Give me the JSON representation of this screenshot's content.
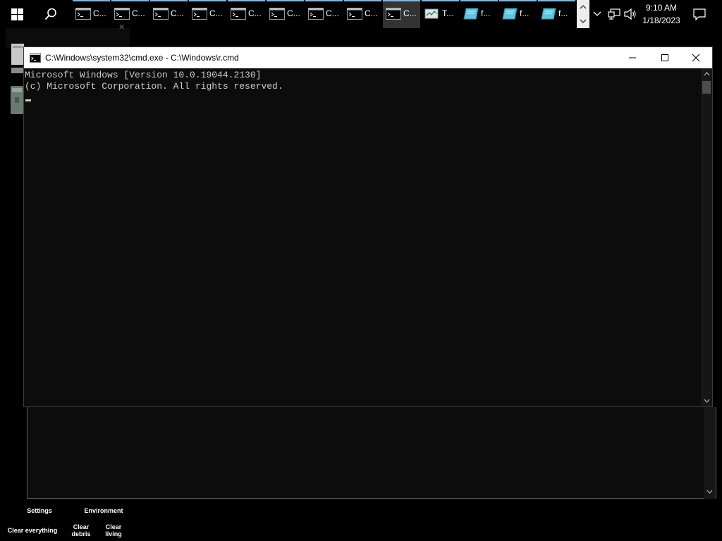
{
  "taskbar": {
    "tasks": [
      {
        "label": "C...",
        "icon": "cmd-icon",
        "active": false
      },
      {
        "label": "C...",
        "icon": "cmd-icon",
        "active": false
      },
      {
        "label": "C...",
        "icon": "cmd-icon",
        "active": false
      },
      {
        "label": "C...",
        "icon": "cmd-icon",
        "active": false
      },
      {
        "label": "C...",
        "icon": "cmd-icon",
        "active": false
      },
      {
        "label": "C...",
        "icon": "cmd-icon",
        "active": false
      },
      {
        "label": "C...",
        "icon": "cmd-icon",
        "active": false
      },
      {
        "label": "C...",
        "icon": "cmd-icon",
        "active": false
      },
      {
        "label": "C...",
        "icon": "cmd-icon",
        "active": true
      },
      {
        "label": "T...",
        "icon": "task-manager-icon",
        "active": false
      },
      {
        "label": "f...",
        "icon": "notepad-icon",
        "active": false
      },
      {
        "label": "f...",
        "icon": "notepad-icon",
        "active": false
      },
      {
        "label": "f...",
        "icon": "notepad-icon",
        "active": false
      }
    ],
    "clock": {
      "time": "9:10 AM",
      "date": "1/18/2023"
    }
  },
  "cmd_window": {
    "title": "C:\\Windows\\system32\\cmd.exe - C:\\Windows\\r.cmd",
    "lines": [
      "Microsoft Windows [Version 10.0.19044.2130]",
      "(c) Microsoft Corporation. All rights reserved."
    ]
  },
  "game_panel": {
    "settings": "Settings",
    "environment": "Environment",
    "clear_everything": "Clear everything",
    "clear_debris_1": "Clear",
    "clear_debris_2": "debris",
    "clear_living_1": "Clear",
    "clear_living_2": "living"
  },
  "colors": {
    "taskbar_bg": "#000000",
    "task_indicator": "#76b9ed",
    "console_bg": "#0c0c0c",
    "console_text": "#cccccc",
    "titlebar_bg": "#ffffff"
  }
}
